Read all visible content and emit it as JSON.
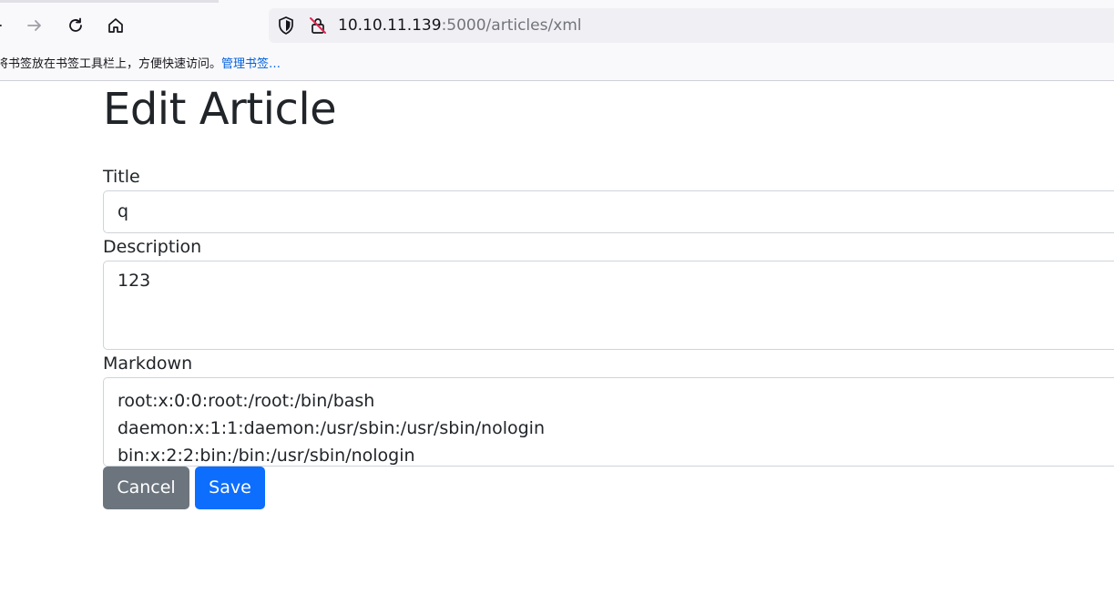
{
  "browser": {
    "url_host": "10.10.11.139",
    "url_path": ":5000/articles/xml"
  },
  "bookmarks_bar": {
    "hint_text": "将书签放在书签工具栏上，方便快速访问。",
    "manage_link": "管理书签…"
  },
  "page": {
    "title": "Edit Article",
    "fields": {
      "title": {
        "label": "Title",
        "value": "q"
      },
      "description": {
        "label": "Description",
        "value": "123"
      },
      "markdown": {
        "label": "Markdown",
        "lines": [
          "root:x:0:0:root:/root:/bin/bash",
          "daemon:x:1:1:daemon:/usr/sbin:/usr/sbin/nologin",
          "bin:x:2:2:bin:/bin:/usr/sbin/nologin"
        ]
      }
    },
    "buttons": {
      "cancel": "Cancel",
      "save": "Save"
    }
  },
  "colors": {
    "cancel_button": "#6c757d",
    "save_button": "#0d6efd",
    "link": "#0061e0"
  }
}
